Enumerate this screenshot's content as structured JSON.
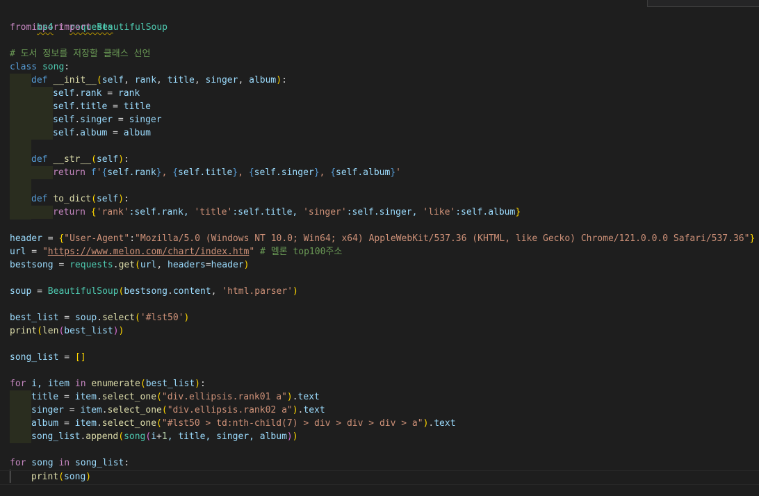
{
  "code": {
    "line1": {
      "kw": "import",
      "mod": "requests"
    },
    "line2": {
      "kw1": "from",
      "mod": "bs4",
      "kw2": "import",
      "cls": "BeautifulSoup"
    },
    "line4": {
      "comment": "# 도서 정보를 저장할 클래스 선언"
    },
    "line5": {
      "kw": "class",
      "name": "song",
      ":": ":"
    },
    "line6": {
      "kw": "def",
      "fn": "__init__",
      "open": "(",
      "p1": "self",
      ",1": ", ",
      "p2": "rank",
      ",2": ", ",
      "p3": "title",
      ",3": ", ",
      "p4": "singer",
      ",4": ", ",
      "p5": "album",
      "close": ")",
      "colon": ":"
    },
    "line7": {
      "a": "self",
      "b": ".",
      "c": "rank",
      "d": " = ",
      "e": "rank"
    },
    "line8": {
      "a": "self",
      "b": ".",
      "c": "title",
      "d": " = ",
      "e": "title"
    },
    "line9": {
      "a": "self",
      "b": ".",
      "c": "singer",
      "d": " = ",
      "e": "singer"
    },
    "line10": {
      "a": "self",
      "b": ".",
      "c": "album",
      "d": " = ",
      "e": "album"
    },
    "line12": {
      "kw": "def",
      "fn": "__str__",
      "open": "(",
      "p": "self",
      "close": ")",
      "colon": ":"
    },
    "line13": {
      "kw": "return",
      "f": "f",
      "q1": "'",
      "b1": "{",
      "e1": "self.rank",
      "c1": "}",
      ", ": ", ",
      "b2": "{",
      "e2": "self.title",
      "c2": "}",
      "s2": ", ",
      "b3": "{",
      "e3": "self.singer",
      "c3": "}",
      "s3": ", ",
      "b4": "{",
      "e4": "self.album",
      "c4": "}",
      "q2": "'"
    },
    "line15": {
      "kw": "def",
      "fn": "to_dict",
      "open": "(",
      "p": "self",
      "close": ")",
      "colon": ":"
    },
    "line16": {
      "kw": "return",
      "ob": "{",
      "k1": "'rank'",
      "v1": ":self.rank, ",
      "k2": "'title'",
      "v2": ":self.title, ",
      "k3": "'singer'",
      "v3": ":self.singer, ",
      "k4": "'like'",
      "v4": ":self.album",
      "cb": "}"
    },
    "line18": {
      "v": "header",
      "eq": " = ",
      "ob": "{",
      "k": "\"User-Agent\"",
      "colon": ":",
      "val": "\"Mozilla/5.0 (Windows NT 10.0; Win64; x64) AppleWebKit/537.36 (KHTML, like Gecko) Chrome/121.0.0.0 Safari/537.36\"",
      "cb": "}"
    },
    "line19": {
      "v": "url",
      "eq": " = ",
      "q1": "\"",
      "link": "https://www.melon.com/chart/index.htm",
      "q2": "\"",
      "comment": " # 멜론 top100주소"
    },
    "line20": {
      "v": "bestsong",
      "eq": " = ",
      "mod": "requests",
      "dot": ".",
      "fn": "get",
      "open": "(",
      "a1": "url",
      ", ": ", ",
      "a2": "headers",
      "eq2": "=",
      "a3": "header",
      "close": ")"
    },
    "line22": {
      "v": "soup",
      "eq": " = ",
      "cls": "BeautifulSoup",
      "open": "(",
      "a1": "bestsong",
      "dot": ".",
      "a2": "content",
      ", ": ", ",
      "s": "'html.parser'",
      "close": ")"
    },
    "line24": {
      "v": "best_list",
      "eq": " = ",
      "o": "soup",
      "dot": ".",
      "fn": "select",
      "open": "(",
      "s": "'#lst50'",
      "close": ")"
    },
    "line25": {
      "fn": "print",
      "open": "(",
      "fn2": "len",
      "open2": "(",
      "a": "best_list",
      "close2": ")",
      "close": ")"
    },
    "line27": {
      "v": "song_list",
      "eq": " = ",
      "br": "[]"
    },
    "line29": {
      "kw": "for",
      "a": " i, ",
      "b": "item",
      "kw2": " in ",
      "fn": "enumerate",
      "open": "(",
      "c": "best_list",
      "close": ")",
      "colon": ":"
    },
    "line30": {
      "v": "title",
      "eq": " = ",
      "o": "item",
      "dot": ".",
      "fn": "select_one",
      "open": "(",
      "s": "\"div.ellipsis.rank01 a\"",
      "close": ")",
      "dot2": ".",
      "attr": "text"
    },
    "line31": {
      "v": "singer",
      "eq": " = ",
      "o": "item",
      "dot": ".",
      "fn": "select_one",
      "open": "(",
      "s": "\"div.ellipsis.rank02 a\"",
      "close": ")",
      "dot2": ".",
      "attr": "text"
    },
    "line32": {
      "v": "album",
      "eq": " = ",
      "o": "item",
      "dot": ".",
      "fn": "select_one",
      "open": "(",
      "s": "\"#lst50 > td:nth-child(7) > div > div > div > a\"",
      "close": ")",
      "dot2": ".",
      "attr": "text"
    },
    "line33": {
      "o": "song_list",
      "dot": ".",
      "fn": "append",
      "open": "(",
      "cls": "song",
      "open2": "(",
      "a1": "i",
      "op": "+",
      "n": "1",
      "rest": ", title, singer, album",
      "close2": ")",
      "close": ")"
    },
    "line35": {
      "kw": "for",
      "a": " song",
      "kw2": " in ",
      "b": "song_list",
      "colon": ":"
    },
    "line36": {
      "fn": "print",
      "open": "(",
      "a": "song",
      "close": ")"
    }
  },
  "colors": {
    "background": "#1e1e1e",
    "keyword": "#569cd6",
    "control": "#c586c0",
    "function": "#dcdcaa",
    "class": "#4ec9b0",
    "variable": "#9cdcfe",
    "string": "#ce9178",
    "comment": "#6a9955"
  }
}
